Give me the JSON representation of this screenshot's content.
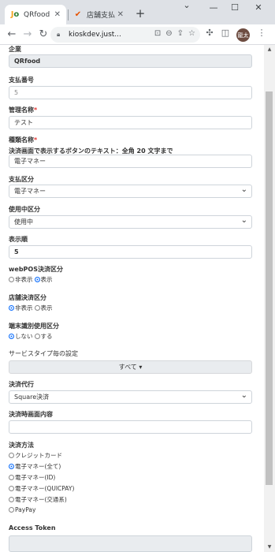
{
  "browser": {
    "tabs": [
      {
        "title": "QRfood",
        "active": true
      },
      {
        "title": "店舗支払",
        "active": false
      }
    ],
    "url": "kioskdev.just...",
    "profile_initials": "龍太",
    "window_controls": {
      "minimize": "—",
      "maximize": "☐",
      "close": "✕"
    },
    "new_tab": "+"
  },
  "form": {
    "company": {
      "label": "企業",
      "value": "QRfood"
    },
    "payment_no": {
      "label": "支払番号",
      "value": "5"
    },
    "admin_name": {
      "label": "管理名称",
      "value": "テスト"
    },
    "type_name": {
      "label": "種類名称",
      "hint": "決済画面で表示するボタンのテキスト：全角 20 文字まで",
      "value": "電子マネー"
    },
    "payment_category": {
      "label": "支払区分",
      "value": "電子マネー"
    },
    "usage_category": {
      "label": "使用中区分",
      "value": "使用中"
    },
    "display_order": {
      "label": "表示順",
      "value": "5"
    },
    "webpos": {
      "label": "webPOS決済区分",
      "options": [
        "非表示",
        "表示"
      ],
      "selected": 1
    },
    "store_payment": {
      "label": "店舗決済区分",
      "options": [
        "非表示",
        "表示"
      ],
      "selected": 0
    },
    "terminal": {
      "label": "端末識別使用区分",
      "options": [
        "しない",
        "する"
      ],
      "selected": 0
    },
    "service_type": {
      "label": "サービスタイプ毎の設定",
      "button": "すべて ▾"
    },
    "payment_agent": {
      "label": "決済代行",
      "value": "Square決済"
    },
    "payment_screen": {
      "label": "決済時画面内容",
      "value": ""
    },
    "payment_method": {
      "label": "決済方法",
      "options": [
        "クレジットカード",
        "電子マネー(全て)",
        "電子マネー(ID)",
        "電子マネー(QUICPAY)",
        "電子マネー(交通系)",
        "PayPay"
      ],
      "selected": 1
    },
    "access_token": {
      "label": "Access Token"
    }
  },
  "colors": {
    "accent": "#0d6efd",
    "required": "#e53935"
  }
}
